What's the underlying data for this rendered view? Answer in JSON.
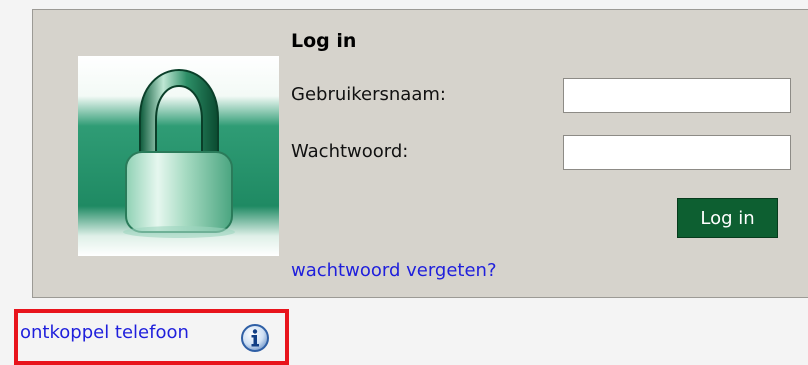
{
  "login": {
    "title": "Log in",
    "username_label": "Gebruikersnaam:",
    "username_value": "",
    "password_label": "Wachtwoord:",
    "password_value": "",
    "submit_label": "Log in",
    "forgot_link": "wachtwoord vergeten?",
    "image_icon": "padlock-icon"
  },
  "footer": {
    "disconnect_link": "ontkoppel telefoon",
    "info_icon": "info-icon"
  },
  "colors": {
    "panel_bg": "#d6d3cc",
    "button_bg": "#0d5f31",
    "link": "#1f1fdc",
    "highlight": "#e8141c"
  }
}
